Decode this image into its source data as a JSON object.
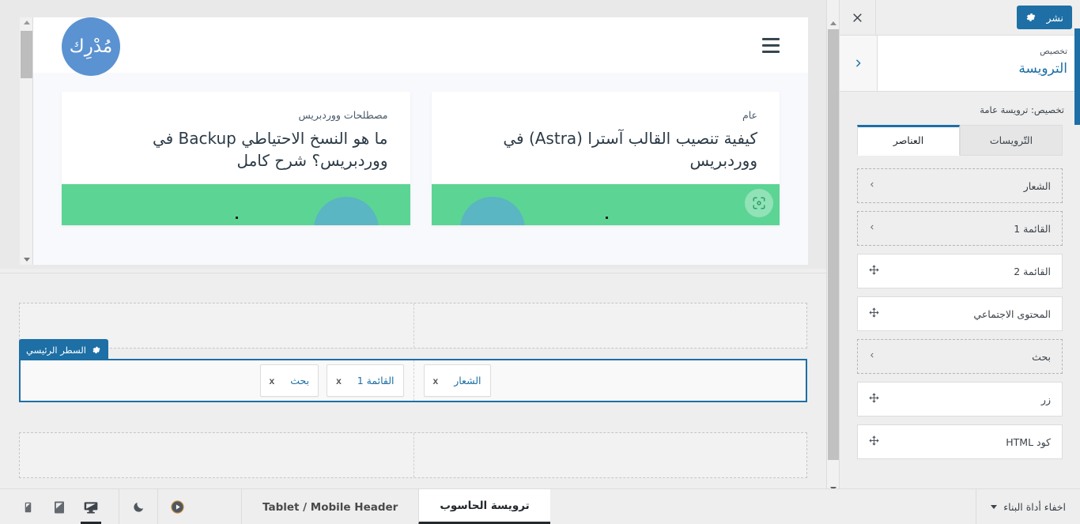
{
  "panel": {
    "publish_label": "نشر",
    "publish_icon": "gear-icon",
    "close_icon": "close-icon",
    "back_icon": "chevron-right-icon",
    "eyebrow": "تخصيص",
    "title": "الترويسة",
    "subtitle": "تخصيص: ترويسة عامة",
    "tabs": [
      {
        "label": "التّرويسات",
        "active": false
      },
      {
        "label": "العناصر",
        "active": true
      }
    ],
    "items": [
      {
        "label": "الشعار",
        "style": "dashed",
        "icon": "chevron-left-icon"
      },
      {
        "label": "القائمة 1",
        "style": "dashed",
        "icon": "chevron-left-icon"
      },
      {
        "label": "القائمة 2",
        "style": "solid",
        "icon": "move-icon"
      },
      {
        "label": "المحتوى الاجتماعي",
        "style": "solid",
        "icon": "move-icon"
      },
      {
        "label": "بحث",
        "style": "dashed",
        "icon": "chevron-left-icon"
      },
      {
        "label": "زر",
        "style": "solid",
        "icon": "move-icon"
      },
      {
        "label": "كود HTML",
        "style": "solid",
        "icon": "move-icon"
      }
    ]
  },
  "preview": {
    "logo_text": "مُدْرِك",
    "menu_icon": "hamburger-menu-icon",
    "cards": [
      {
        "category": "عام",
        "title": "كيفية تنصيب القالب آسترا (Astra) في ووردبريس",
        "thumb_icon": "image-placeholder-icon"
      },
      {
        "category": "مصطلحات ووردبريس",
        "title": "ما هو النسخ الاحتياطي Backup في ووردبريس؟ شرح كامل",
        "thumb_icon": ""
      }
    ]
  },
  "builder": {
    "active_row_label": "السطر الرئيسي",
    "active_row_icon": "gear-icon",
    "remove_icon": "x",
    "rows": [
      {
        "name": "top-row",
        "active": false,
        "start_items": [],
        "end_items": []
      },
      {
        "name": "main-row",
        "active": true,
        "start_items": [
          "بحث",
          "القائمة 1"
        ],
        "end_items": [
          "الشعار"
        ]
      },
      {
        "name": "bottom-row",
        "active": false,
        "start_items": [],
        "end_items": []
      }
    ]
  },
  "bottom_bar": {
    "hide_builder_label": "اخفاء أداة البناء",
    "hide_builder_icon": "chevron-down-icon",
    "tabs": [
      {
        "label": "ترويسة الحاسوب",
        "active": true
      },
      {
        "label": "Tablet / Mobile Header",
        "active": false
      }
    ],
    "devices": [
      {
        "name": "mobile-view",
        "icon": "mobile-icon",
        "active": false
      },
      {
        "name": "tablet-view",
        "icon": "tablet-icon",
        "active": false
      },
      {
        "name": "desktop-view",
        "icon": "desktop-icon",
        "active": true
      }
    ],
    "dark_mode_icon": "moon-icon",
    "preview_icon": "play-circle-icon"
  },
  "colors": {
    "accent_blue": "#1d6fa5",
    "brand_blue": "#5b92d1",
    "thumb_green": "#5cd494",
    "thumb_teal": "#59b6c2",
    "panel_bg": "#eeeeee"
  }
}
